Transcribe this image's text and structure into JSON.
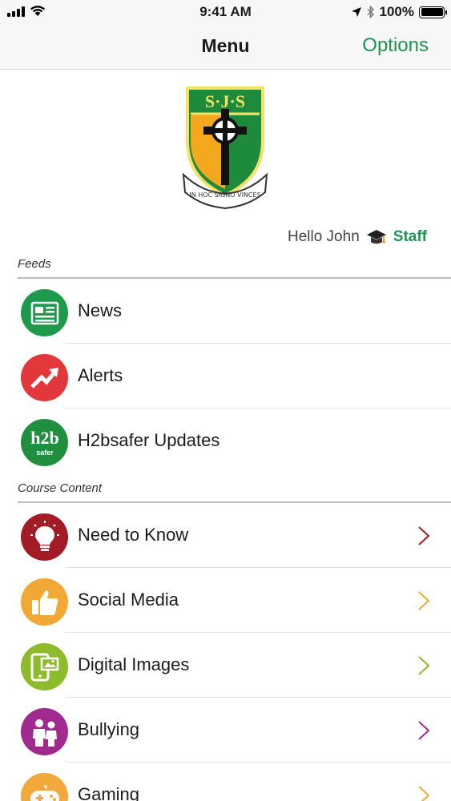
{
  "status_bar": {
    "time": "9:41 AM",
    "battery_percent": "100%"
  },
  "nav": {
    "title": "Menu",
    "options_label": "Options"
  },
  "crest": {
    "initials": "S·J·S",
    "motto": "IN HOC SIGNO VINCES"
  },
  "greeting": {
    "text": "Hello John",
    "role": "Staff"
  },
  "sections": {
    "feeds": "Feeds",
    "course_content": "Course Content"
  },
  "feeds": [
    {
      "label": "News",
      "icon": "newspaper-icon",
      "color": "#1f9a4c"
    },
    {
      "label": "Alerts",
      "icon": "trend-up-icon",
      "color": "#e2383b"
    },
    {
      "label": "H2bsafer Updates",
      "icon": "h2b-logo-icon",
      "color": "#1f8e3f",
      "logo_text": "h2b",
      "logo_sub": "safer"
    }
  ],
  "course_content": [
    {
      "label": "Need to Know",
      "icon": "lightbulb-icon",
      "color": "#a31c25"
    },
    {
      "label": "Social Media",
      "icon": "thumbs-up-icon",
      "color": "#f1a935"
    },
    {
      "label": "Digital Images",
      "icon": "tablet-image-icon",
      "color": "#8dbb2b"
    },
    {
      "label": "Bullying",
      "icon": "people-icon",
      "color": "#a12a8e"
    },
    {
      "label": "Gaming",
      "icon": "gamepad-icon",
      "color": "#f2a93b"
    }
  ],
  "colors": {
    "accent": "#1e9451"
  }
}
